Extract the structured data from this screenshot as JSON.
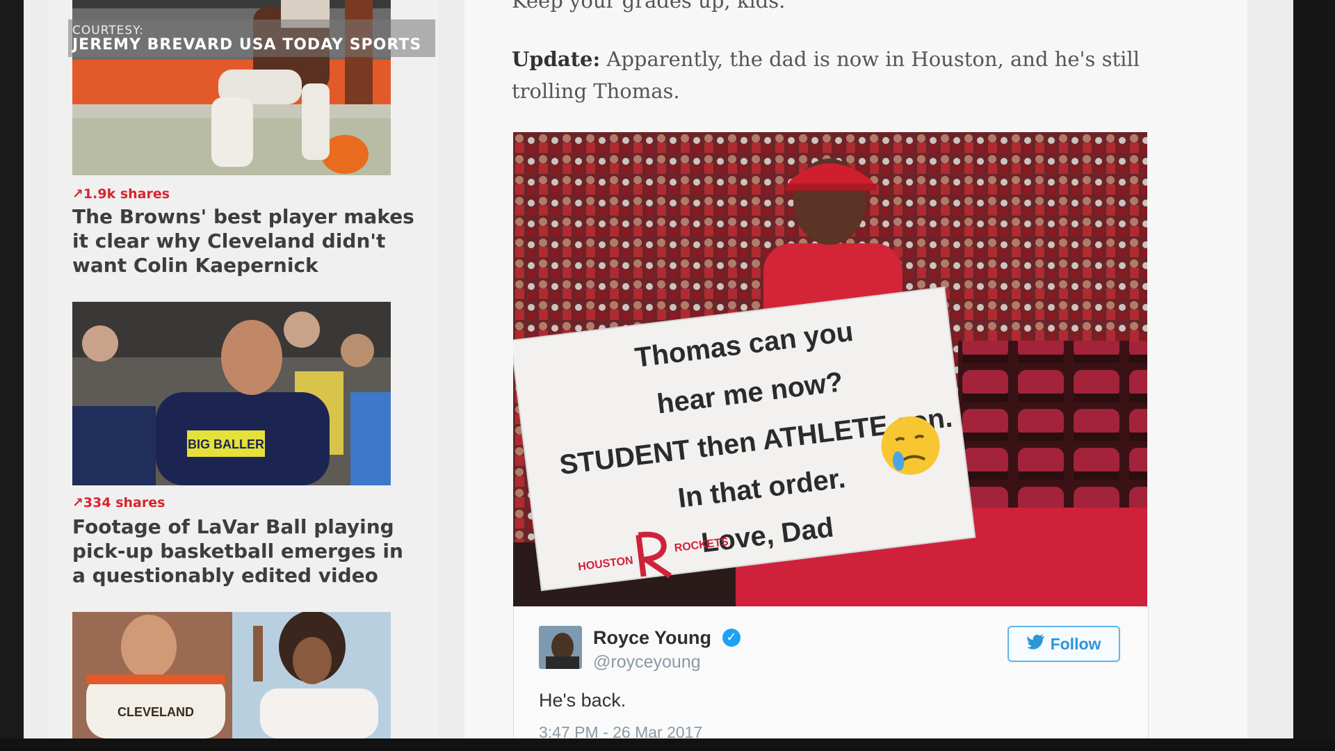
{
  "sidebar": {
    "photo_credit_label": "COURTESY:",
    "photo_credit_name": "JEREMY BREVARD USA TODAY SPORTS",
    "stories": [
      {
        "shares": "↗1.9k shares",
        "title": "The Browns' best player makes it clear why Cleveland didn't want Colin Kaepernick"
      },
      {
        "shares": "↗334 shares",
        "title": "Footage of LaVar Ball playing pick-up basketball emerges in a questionably edited video",
        "image_text": "BIG BALLER"
      },
      {
        "image_text": "CLEVELAND"
      }
    ]
  },
  "article": {
    "top_line": "Keep your grades up, kids.",
    "update_label": "Update:",
    "update_text": " Apparently, the dad is now in Houston, and he's still trolling Thomas."
  },
  "sign": {
    "line1": "Thomas can you",
    "line2": "hear me now?",
    "line3": "STUDENT then ATHLETE son.",
    "line4": "In that order.",
    "line5": "Love, Dad",
    "logo_left": "HOUSTON",
    "logo_right": "ROCKETS"
  },
  "tweet": {
    "name": "Royce Young",
    "handle": "@royceyoung",
    "follow_label": "Follow",
    "text": "He's back.",
    "timestamp": "3:47 PM - 26 Mar 2017"
  },
  "colors": {
    "accent_red": "#d8242c",
    "twitter_blue": "#1da1f2"
  }
}
